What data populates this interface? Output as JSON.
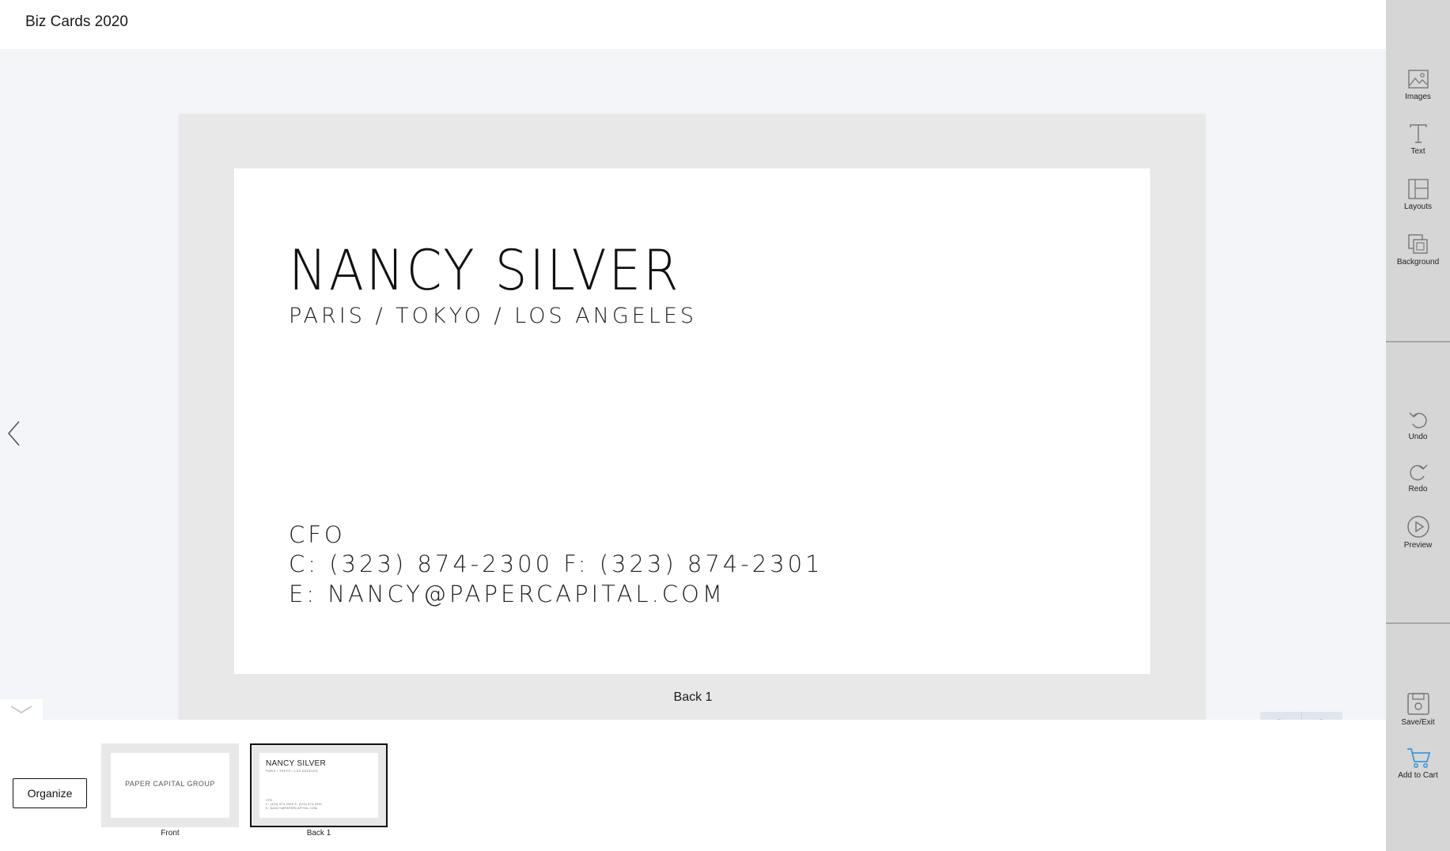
{
  "header": {
    "title": "Biz Cards 2020"
  },
  "card": {
    "name": "NANCY SILVER",
    "cities": "PARIS / TOKYO / LOS ANGELES",
    "title_line": "CFO",
    "phone_line": "C: (323) 874-2300 F: (323) 874-2301",
    "email_line": "E: NANCY@PAPERCAPITAL.COM"
  },
  "canvas": {
    "page_label": "Back 1"
  },
  "filmstrip": {
    "organize_label": "Organize",
    "thumbnails": [
      {
        "label": "Front",
        "text": "PAPER CAPITAL GROUP"
      },
      {
        "label": "Back 1",
        "name": "NANCY SILVER",
        "cities": "PARIS / TOKYO / LOS ANGELES",
        "line1": "CFO",
        "line2": "C: (323) 874-2300 F: (323) 874-2301",
        "line3": "E: NANCY@PAPERCAPITAL.COM"
      }
    ]
  },
  "sidebar": {
    "tools": [
      {
        "label": "Images",
        "icon": "image-icon"
      },
      {
        "label": "Text",
        "icon": "text-icon"
      },
      {
        "label": "Layouts",
        "icon": "layout-icon"
      },
      {
        "label": "Background",
        "icon": "background-icon"
      }
    ],
    "history": [
      {
        "label": "Undo",
        "icon": "undo-icon"
      },
      {
        "label": "Redo",
        "icon": "redo-icon"
      },
      {
        "label": "Preview",
        "icon": "play-icon"
      }
    ],
    "actions": [
      {
        "label": "Save/Exit",
        "icon": "save-icon"
      },
      {
        "label": "Add to Cart",
        "icon": "cart-icon"
      }
    ]
  },
  "colors": {
    "sidebar_bg": "#d6d6d6",
    "canvas_bg": "#f4f5f8",
    "cart_accent": "#3a9ad9"
  }
}
